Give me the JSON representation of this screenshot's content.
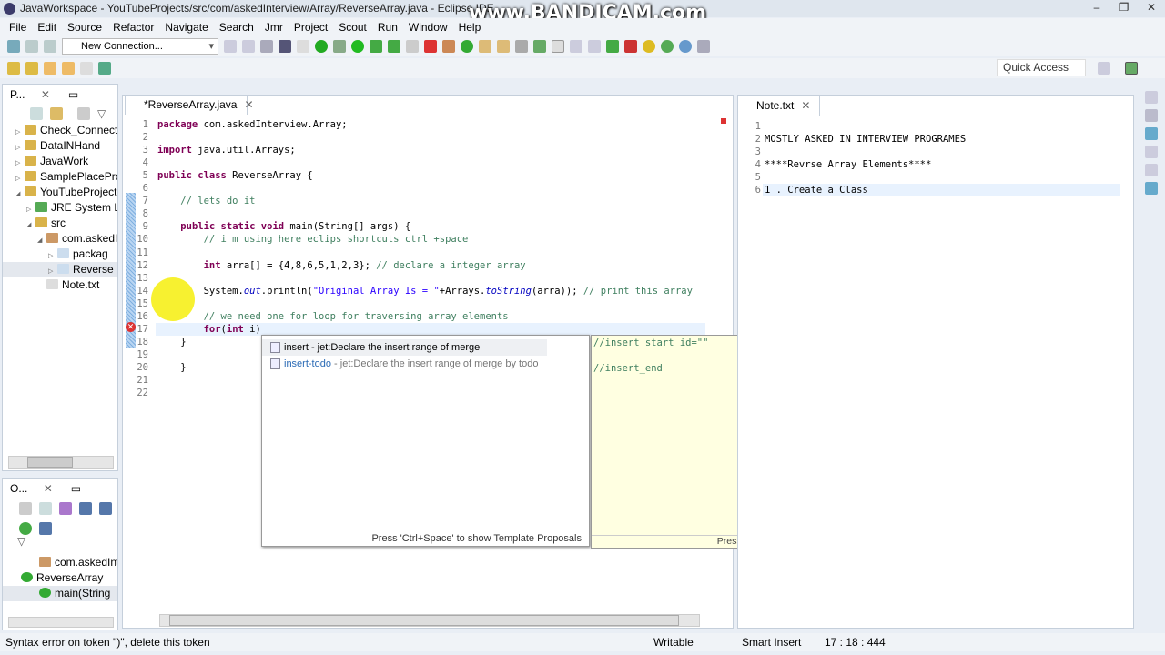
{
  "window": {
    "title": "JavaWorkspace - YouTubeProjects/src/com/askedInterview/Array/ReverseArray.java - Eclipse IDE",
    "watermark": "www.BANDICAM.com"
  },
  "menu": [
    "File",
    "Edit",
    "Source",
    "Refactor",
    "Navigate",
    "Search",
    "Jmr",
    "Project",
    "Scout",
    "Run",
    "Window",
    "Help"
  ],
  "toolbar": {
    "connection": "New Connection...",
    "quick_access": "Quick Access"
  },
  "package_explorer": {
    "tab": "P...",
    "items": [
      {
        "label": "Check_Connectt",
        "indent": 0,
        "exp": "▷"
      },
      {
        "label": "DataINHand",
        "indent": 0,
        "exp": "▷"
      },
      {
        "label": "JavaWork",
        "indent": 0,
        "exp": "▷"
      },
      {
        "label": "SamplePlaceProj",
        "indent": 0,
        "exp": "▷"
      },
      {
        "label": "YouTubeProjects",
        "indent": 0,
        "exp": "◢"
      },
      {
        "label": "JRE System Li",
        "indent": 1,
        "exp": "▷"
      },
      {
        "label": "src",
        "indent": 1,
        "exp": "◢"
      },
      {
        "label": "com.askedI",
        "indent": 2,
        "exp": "◢"
      },
      {
        "label": "packag",
        "indent": 3,
        "exp": "▷"
      },
      {
        "label": "Reverse",
        "indent": 3,
        "exp": "▷"
      },
      {
        "label": "Note.txt",
        "indent": 2,
        "exp": ""
      }
    ]
  },
  "outline": {
    "tab": "O...",
    "items": [
      {
        "label": "com.askedInte",
        "indent": 1
      },
      {
        "label": "ReverseArray",
        "indent": 0
      },
      {
        "label": "main(String",
        "indent": 1
      }
    ]
  },
  "editor": {
    "tab": "*ReverseArray.java",
    "lines": [
      [
        [
          "kw",
          "package"
        ],
        [
          "pl",
          " com.askedInterview.Array;"
        ]
      ],
      [],
      [
        [
          "kw",
          "import"
        ],
        [
          "pl",
          " java.util.Arrays;"
        ]
      ],
      [],
      [
        [
          "kw",
          "public class"
        ],
        [
          "pl",
          " ReverseArray {"
        ]
      ],
      [],
      [
        [
          "cm",
          "    // lets do it"
        ]
      ],
      [],
      [
        [
          "pl",
          "    "
        ],
        [
          "kw",
          "public static void"
        ],
        [
          "pl",
          " main(String[] args) {"
        ]
      ],
      [
        [
          "cm",
          "        // i m using here eclips shortcuts ctrl +space"
        ]
      ],
      [],
      [
        [
          "pl",
          "        "
        ],
        [
          "kw",
          "int"
        ],
        [
          "pl",
          " arra[] = {4,8,6,5,1,2,3}; "
        ],
        [
          "cm",
          "// declare a integer array"
        ]
      ],
      [],
      [
        [
          "pl",
          "        System."
        ],
        [
          "it",
          "out"
        ],
        [
          "pl",
          ".println("
        ],
        [
          "st",
          "\"Original Array Is = \""
        ],
        [
          "pl",
          "+Arrays."
        ],
        [
          "it",
          "toString"
        ],
        [
          "pl",
          "(arra)); "
        ],
        [
          "cm",
          "// print this array"
        ]
      ],
      [],
      [
        [
          "cm",
          "        // we need one for loop for traversing array elements"
        ]
      ],
      [
        [
          "pl",
          "        "
        ],
        [
          "kw",
          "for"
        ],
        [
          "pl",
          "("
        ],
        [
          "kw",
          "int"
        ],
        [
          "pl",
          " i)"
        ]
      ],
      [
        [
          "pl",
          "    }"
        ]
      ],
      [],
      [
        [
          "pl",
          "    }"
        ]
      ],
      [],
      []
    ]
  },
  "content_assist": {
    "proposals": [
      {
        "name": "insert",
        "desc": " - jet:Declare the insert range of merge"
      },
      {
        "name": "insert-todo",
        "desc": " - jet:Declare the insert range of merge by todo"
      }
    ],
    "footer": "Press 'Ctrl+Space' to show Template Proposals",
    "preview": [
      "//insert_start id=\"\"",
      "",
      "//insert_end"
    ],
    "preview_footer": "Press 'Tab' from proposal table or click for focus"
  },
  "note": {
    "tab": "Note.txt",
    "lines": [
      "",
      "MOSTLY ASKED IN INTERVIEW PROGRAMES",
      "",
      "****Revrse Array Elements****",
      "",
      "1 . Create a Class"
    ]
  },
  "status": {
    "message": "Syntax error on token \")\", delete this token",
    "mode": "Writable",
    "insert": "Smart Insert",
    "position": "17 : 18 : 444"
  }
}
